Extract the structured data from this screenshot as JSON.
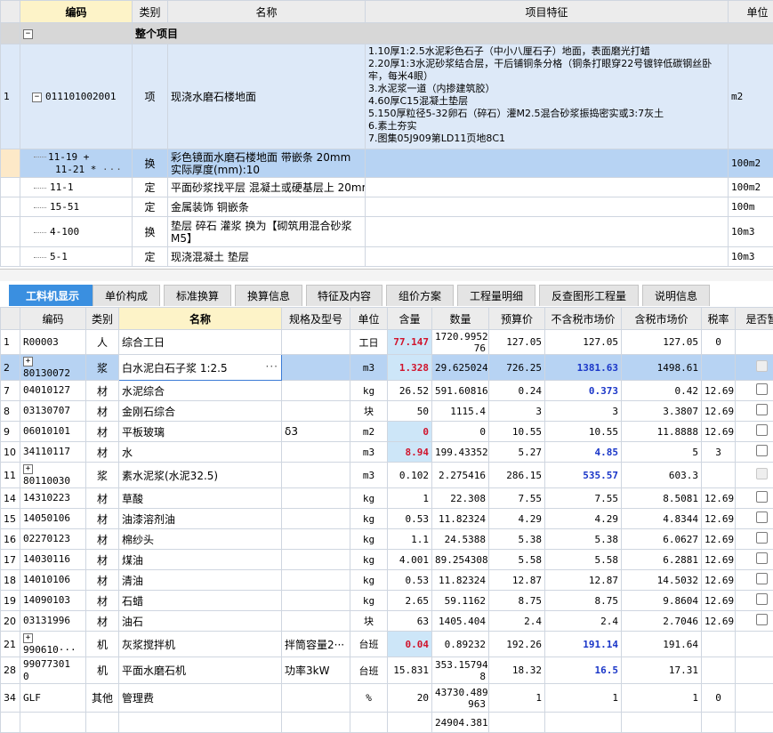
{
  "top": {
    "columns": {
      "code": "编码",
      "type": "类别",
      "name": "名称",
      "feature": "项目特征",
      "unit": "单位"
    },
    "group": {
      "label": "整个项目"
    },
    "main": {
      "rownum": "1",
      "code": "011101002001",
      "type": "项",
      "name": "现浇水磨石楼地面",
      "features": [
        "1.10厚1:2.5水泥彩色石子（中小八厘石子）地面，表面磨光打蜡",
        "2.20厚1:3水泥砂浆结合层，干后铺铜条分格（铜条打眼穿22号镀锌低碳钢丝卧牢，每米4眼）",
        "3.水泥浆一道（内掺建筑胶）",
        "4.60厚C15混凝土垫层",
        "5.150厚粒径5-32卵石（碎石）灌M2.5混合砂浆振捣密实或3:7灰土",
        "6.素土夯实",
        "7.图集05J909第LD11页地8C1"
      ],
      "unit": "m2"
    },
    "subs": [
      {
        "code1": "11-19 +",
        "code2": "11-21 *",
        "ellipsis": "···",
        "type": "换",
        "name": "彩色镜面水磨石楼地面 带嵌条 20mm  实际厚度(mm):10",
        "unit": "100m2"
      },
      {
        "code": "11-1",
        "type": "定",
        "name": "平面砂浆找平层 混凝土或硬基层上 20mm",
        "unit": "100m2"
      },
      {
        "code": "15-51",
        "type": "定",
        "name": "金属装饰 铜嵌条",
        "unit": "100m"
      },
      {
        "code": "4-100",
        "type": "换",
        "name": "垫层 碎石 灌浆  换为【砌筑用混合砂浆 M5】",
        "unit": "10m3"
      },
      {
        "code": "5-1",
        "type": "定",
        "name": "现浇混凝土 垫层",
        "unit": "10m3"
      }
    ]
  },
  "tabs": [
    "工料机显示",
    "单价构成",
    "标准换算",
    "换算信息",
    "特征及内容",
    "组价方案",
    "工程量明细",
    "反查图形工程量",
    "说明信息"
  ],
  "bottom": {
    "columns": {
      "code": "编码",
      "type": "类别",
      "name": "名称",
      "spec": "规格及型号",
      "unit": "单位",
      "qty": "含量",
      "amount": "数量",
      "budget": "预算价",
      "ex_tax": "不含税市场价",
      "in_tax": "含税市场价",
      "rate": "税率",
      "flag": "是否暂"
    },
    "rows": [
      {
        "no": "1",
        "code": "R00003",
        "type": "人",
        "name": "综合工日",
        "spec": "",
        "unit": "工日",
        "qty": "77.147",
        "amount": "1720.9952\n76",
        "budget": "127.05",
        "ex_tax": "127.05",
        "in_tax": "127.05",
        "rate": "0",
        "cb": "none",
        "qtyStyle": "red",
        "exStyle": ""
      },
      {
        "no": "2",
        "code": "80130072",
        "type": "浆",
        "name": "白水泥白石子浆 1:2.5",
        "ellipsis": "···",
        "spec": "",
        "unit": "m3",
        "qty": "1.328",
        "amount": "29.625024",
        "budget": "726.25",
        "ex_tax": "1381.63",
        "in_tax": "1498.61",
        "rate": "",
        "cb": "dis",
        "qtyStyle": "red",
        "exStyle": "blue",
        "plus": true,
        "selected": true
      },
      {
        "no": "7",
        "code": "04010127",
        "type": "材",
        "name": "水泥综合",
        "spec": "",
        "unit": "kg",
        "qty": "26.52",
        "amount": "591.60816",
        "budget": "0.24",
        "ex_tax": "0.373",
        "in_tax": "0.42",
        "rate": "12.69",
        "cb": "on",
        "qtyStyle": "",
        "exStyle": "blue"
      },
      {
        "no": "8",
        "code": "03130707",
        "type": "材",
        "name": "金刚石综合",
        "spec": "",
        "unit": "块",
        "qty": "50",
        "amount": "1115.4",
        "budget": "3",
        "ex_tax": "3",
        "in_tax": "3.3807",
        "rate": "12.69",
        "cb": "on",
        "qtyStyle": "",
        "exStyle": ""
      },
      {
        "no": "9",
        "code": "06010101",
        "type": "材",
        "name": "平板玻璃",
        "spec": "δ3",
        "unit": "m2",
        "qty": "0",
        "amount": "0",
        "budget": "10.55",
        "ex_tax": "10.55",
        "in_tax": "11.8888",
        "rate": "12.69",
        "cb": "on",
        "qtyStyle": "red",
        "exStyle": ""
      },
      {
        "no": "10",
        "code": "34110117",
        "type": "材",
        "name": "水",
        "spec": "",
        "unit": "m3",
        "qty": "8.94",
        "amount": "199.43352",
        "budget": "5.27",
        "ex_tax": "4.85",
        "in_tax": "5",
        "rate": "3",
        "cb": "on",
        "qtyStyle": "red",
        "exStyle": "blue"
      },
      {
        "no": "11",
        "code": "80110030",
        "type": "浆",
        "name": "素水泥浆(水泥32.5)",
        "spec": "",
        "unit": "m3",
        "qty": "0.102",
        "amount": "2.275416",
        "budget": "286.15",
        "ex_tax": "535.57",
        "in_tax": "603.3",
        "rate": "",
        "cb": "dis",
        "qtyStyle": "",
        "exStyle": "blue",
        "plus": true
      },
      {
        "no": "14",
        "code": "14310223",
        "type": "材",
        "name": "草酸",
        "spec": "",
        "unit": "kg",
        "qty": "1",
        "amount": "22.308",
        "budget": "7.55",
        "ex_tax": "7.55",
        "in_tax": "8.5081",
        "rate": "12.69",
        "cb": "on",
        "qtyStyle": "",
        "exStyle": ""
      },
      {
        "no": "15",
        "code": "14050106",
        "type": "材",
        "name": "油漆溶剂油",
        "spec": "",
        "unit": "kg",
        "qty": "0.53",
        "amount": "11.82324",
        "budget": "4.29",
        "ex_tax": "4.29",
        "in_tax": "4.8344",
        "rate": "12.69",
        "cb": "on",
        "qtyStyle": "",
        "exStyle": ""
      },
      {
        "no": "16",
        "code": "02270123",
        "type": "材",
        "name": "棉纱头",
        "spec": "",
        "unit": "kg",
        "qty": "1.1",
        "amount": "24.5388",
        "budget": "5.38",
        "ex_tax": "5.38",
        "in_tax": "6.0627",
        "rate": "12.69",
        "cb": "on",
        "qtyStyle": "",
        "exStyle": ""
      },
      {
        "no": "17",
        "code": "14030116",
        "type": "材",
        "name": "煤油",
        "spec": "",
        "unit": "kg",
        "qty": "4.001",
        "amount": "89.254308",
        "budget": "5.58",
        "ex_tax": "5.58",
        "in_tax": "6.2881",
        "rate": "12.69",
        "cb": "on",
        "qtyStyle": "",
        "exStyle": ""
      },
      {
        "no": "18",
        "code": "14010106",
        "type": "材",
        "name": "清油",
        "spec": "",
        "unit": "kg",
        "qty": "0.53",
        "amount": "11.82324",
        "budget": "12.87",
        "ex_tax": "12.87",
        "in_tax": "14.5032",
        "rate": "12.69",
        "cb": "on",
        "qtyStyle": "",
        "exStyle": ""
      },
      {
        "no": "19",
        "code": "14090103",
        "type": "材",
        "name": "石蜡",
        "spec": "",
        "unit": "kg",
        "qty": "2.65",
        "amount": "59.1162",
        "budget": "8.75",
        "ex_tax": "8.75",
        "in_tax": "9.8604",
        "rate": "12.69",
        "cb": "on",
        "qtyStyle": "",
        "exStyle": ""
      },
      {
        "no": "20",
        "code": "03131996",
        "type": "材",
        "name": "油石",
        "spec": "",
        "unit": "块",
        "qty": "63",
        "amount": "1405.404",
        "budget": "2.4",
        "ex_tax": "2.4",
        "in_tax": "2.7046",
        "rate": "12.69",
        "cb": "on",
        "qtyStyle": "",
        "exStyle": ""
      },
      {
        "no": "21",
        "code": "990610···",
        "type": "机",
        "name": "灰浆搅拌机",
        "spec": "拌筒容量2···",
        "unit": "台班",
        "qty": "0.04",
        "amount": "0.89232",
        "budget": "192.26",
        "ex_tax": "191.14",
        "in_tax": "191.64",
        "rate": "",
        "cb": "none",
        "qtyStyle": "red",
        "exStyle": "blue",
        "plus": true
      },
      {
        "no": "28",
        "code": "99077301\n0",
        "type": "机",
        "name": "平面水磨石机",
        "spec": "功率3kW",
        "unit": "台班",
        "qty": "15.831",
        "amount": "353.15794\n8",
        "budget": "18.32",
        "ex_tax": "16.5",
        "in_tax": "17.31",
        "rate": "",
        "cb": "none",
        "qtyStyle": "",
        "exStyle": "blue"
      },
      {
        "no": "34",
        "code": "GLF",
        "type": "其他",
        "name": "管理费",
        "spec": "",
        "unit": "%",
        "qty": "20",
        "amount": "43730.489\n963",
        "budget": "1",
        "ex_tax": "1",
        "in_tax": "1",
        "rate": "0",
        "cb": "none",
        "qtyStyle": "",
        "exStyle": ""
      },
      {
        "no": "",
        "code": "",
        "type": "",
        "name": "",
        "spec": "",
        "unit": "",
        "qty": "",
        "amount": "24904.381",
        "budget": "",
        "ex_tax": "",
        "in_tax": "",
        "rate": "",
        "cb": "none",
        "qtyStyle": "",
        "exStyle": ""
      }
    ]
  }
}
